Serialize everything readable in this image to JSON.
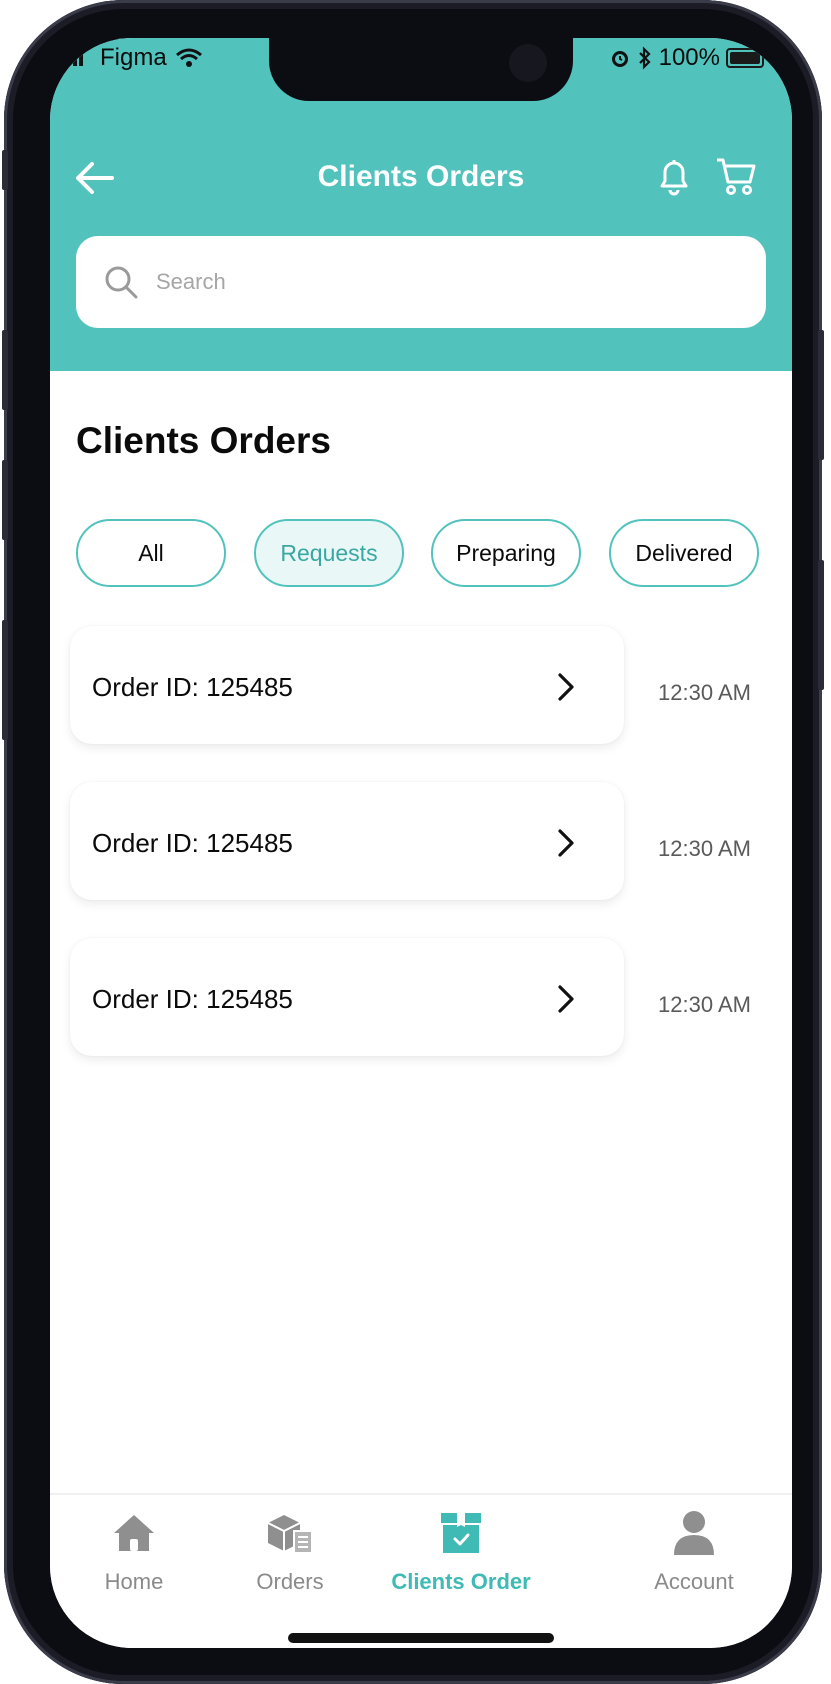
{
  "status_bar": {
    "carrier": "Figma",
    "battery": "100%",
    "icons": [
      "signal-icon",
      "wifi-icon",
      "alarm-icon",
      "bluetooth-icon",
      "battery-icon"
    ]
  },
  "header": {
    "title": "Clients Orders",
    "icons": [
      "back-arrow-icon",
      "bell-icon",
      "cart-icon"
    ],
    "background_color": "#52c2bd"
  },
  "search": {
    "placeholder": "Search",
    "value": ""
  },
  "main": {
    "section_title": "Clients Orders",
    "filters": [
      {
        "label": "All",
        "active": false
      },
      {
        "label": "Requests",
        "active": true
      },
      {
        "label": "Preparing",
        "active": false
      },
      {
        "label": "Delivered",
        "active": false
      }
    ],
    "orders": [
      {
        "label": "Order ID: 125485",
        "time": "12:30 AM"
      },
      {
        "label": "Order ID: 125485",
        "time": "12:30 AM"
      },
      {
        "label": "Order ID: 125485",
        "time": "12:30 AM"
      }
    ]
  },
  "bottom_nav": {
    "items": [
      {
        "label": "Home",
        "icon": "home-icon",
        "active": false
      },
      {
        "label": "Orders",
        "icon": "boxes-icon",
        "active": false
      },
      {
        "label": "Clients Order",
        "icon": "package-check-icon",
        "active": true
      },
      {
        "label": "Account",
        "icon": "user-icon",
        "active": false
      }
    ],
    "active_color": "#3fbab4",
    "inactive_color": "#8a8a8a"
  }
}
